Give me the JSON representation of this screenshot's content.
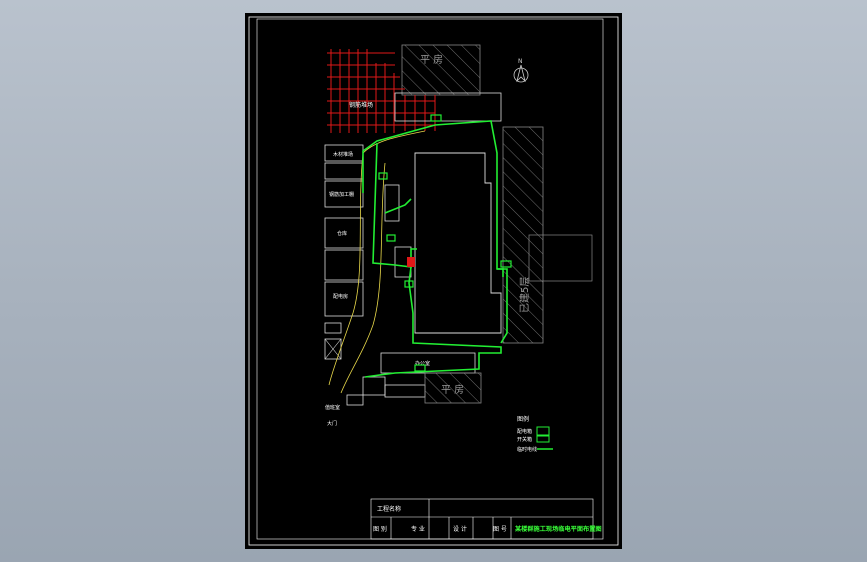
{
  "drawing": {
    "building_labels": {
      "bungalow_top": "平 房",
      "bungalow_bottom": "平 房",
      "main_building_vertical": "已建5层"
    },
    "north_mark": "N",
    "small_labels": [
      "钢筋堆场",
      "木材堆场",
      "钢筋加工棚",
      "仓库",
      "配电房",
      "办公室",
      "值班室",
      "大门"
    ],
    "legend": {
      "title": "图例",
      "items": [
        "配电箱",
        "开关箱",
        "临时电线"
      ]
    },
    "title_block": {
      "project_label": "工程名称",
      "fields": [
        "图 别",
        "专 业",
        "设 计",
        "图 号"
      ],
      "drawing_title": "某楼群施工现场临电平面布置图"
    }
  },
  "colors": {
    "frame": "#ffffff",
    "green": "#22ee33",
    "red": "#e01818",
    "yellow": "#e8d84a",
    "grey_hatch": "#7a7a7a",
    "title_green": "#39ff39"
  }
}
